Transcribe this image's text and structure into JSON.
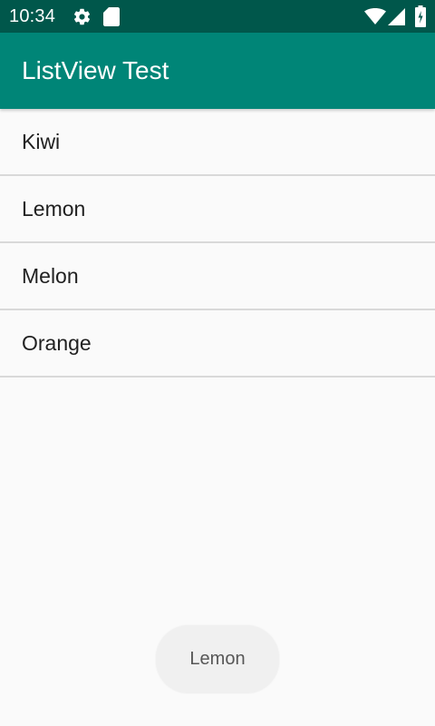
{
  "status_bar": {
    "time": "10:34",
    "background": "#00574b",
    "left_icons": [
      "settings-icon",
      "sd-card-icon"
    ],
    "right_icons": [
      "wifi-icon",
      "cell-signal-icon",
      "battery-icon"
    ]
  },
  "app_bar": {
    "title": "ListView Test",
    "background": "#008577"
  },
  "list": {
    "items": [
      {
        "label": "Kiwi"
      },
      {
        "label": "Lemon"
      },
      {
        "label": "Melon"
      },
      {
        "label": "Orange"
      }
    ]
  },
  "toast": {
    "text": "Lemon"
  }
}
